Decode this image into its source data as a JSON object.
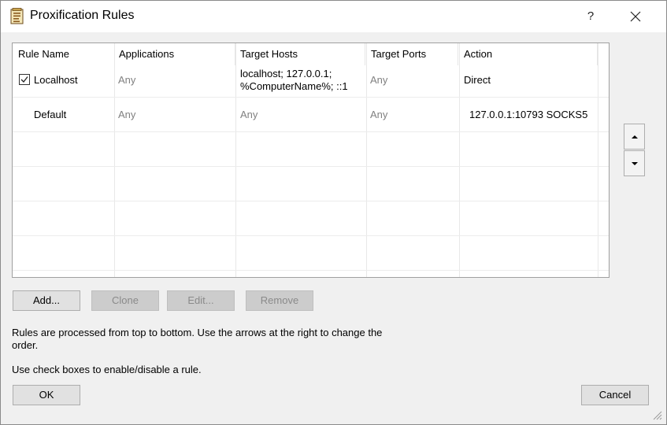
{
  "window": {
    "title": "Proxification Rules",
    "help_label": "?"
  },
  "table": {
    "columns": [
      "Rule Name",
      "Applications",
      "Target Hosts",
      "Target Ports",
      "Action"
    ],
    "rows": [
      {
        "enabled": true,
        "name": "Localhost",
        "applications": "Any",
        "target_hosts_line1": "localhost; 127.0.0.1;",
        "target_hosts_line2": "%ComputerName%; ::1",
        "target_ports": "Any",
        "action": "Direct"
      },
      {
        "name": "Default",
        "applications": "Any",
        "target_hosts": "Any",
        "target_ports": "Any",
        "action": "127.0.0.1:10793 SOCKS5"
      }
    ]
  },
  "buttons": {
    "add": "Add...",
    "clone": "Clone",
    "edit": "Edit...",
    "remove": "Remove",
    "ok": "OK",
    "cancel": "Cancel"
  },
  "info": {
    "line1": "Rules are processed from top to bottom. Use the arrows at the right to change the",
    "line2": "order.",
    "line3": "Use check boxes to enable/disable a rule."
  },
  "icons": {
    "app": "rules-document-icon",
    "close": "close-icon",
    "up": "arrow-up-icon",
    "down": "arrow-down-icon",
    "check": "checkmark-icon"
  }
}
